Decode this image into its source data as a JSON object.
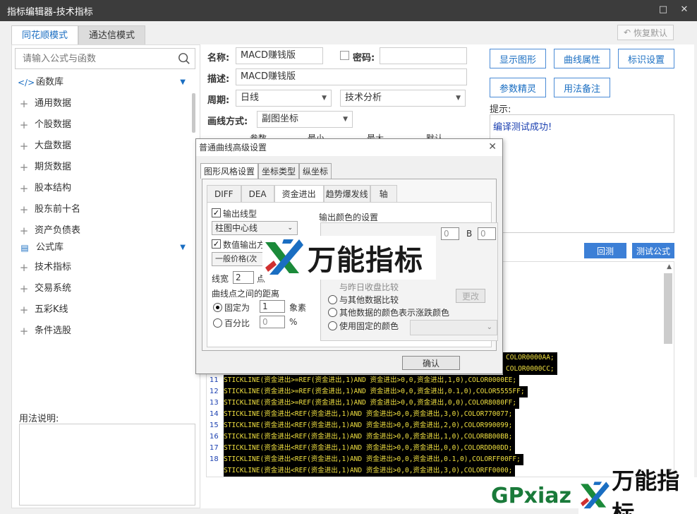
{
  "window": {
    "title": "指标编辑器-技术指标"
  },
  "mode_tabs": [
    {
      "label": "同花顺模式"
    },
    {
      "label": "通达信模式"
    }
  ],
  "restore_label": "恢复默认",
  "search": {
    "placeholder": "请输入公式与函数"
  },
  "tree": {
    "func_header": "函数库",
    "func_items": [
      "通用数据",
      "个股数据",
      "大盘数据",
      "期货数据",
      "股本结构",
      "股东前十名",
      "资产负债表"
    ],
    "formula_header": "公式库",
    "formula_items": [
      "技术指标",
      "交易系统",
      "五彩K线",
      "条件选股"
    ]
  },
  "usage_label": "用法说明:",
  "form": {
    "name_label": "名称:",
    "name_value": "MACD赚钱版",
    "password_label": "密码:",
    "desc_label": "描述:",
    "desc_value": "MACD赚钱版",
    "period_label": "周期:",
    "period_value": "日线",
    "category_value": "技术分析",
    "draw_label": "画线方式:",
    "draw_value": "副图坐标",
    "param_headers": [
      "参数",
      "最小",
      "最大",
      "默认"
    ]
  },
  "buttons": {
    "show_graph": "显示图形",
    "curve_attr": "曲线属性",
    "mark_setting": "标识设置",
    "param_tune": "参数精灵",
    "usage_note": "用法备注",
    "backtest": "回测",
    "test_formula": "测试公式"
  },
  "tip": {
    "label": "提示:",
    "text": "编译测试成功!"
  },
  "code_lines": [
    {
      "num": "",
      "text": "COLOR0000AA;"
    },
    {
      "num": "",
      "text": "COLOR0000CC;"
    },
    {
      "num": "11",
      "text": "STICKLINE(资金进出>=REF(资金进出,1)AND 资金进出>0,0,资金进出,1,0),COLOR0000EE;"
    },
    {
      "num": "12",
      "text": "STICKLINE(资金进出>=REF(资金进出,1)AND 资金进出>0,0,资金进出,0.1,0),COLOR5555FF;"
    },
    {
      "num": "13",
      "text": "STICKLINE(资金进出>=REF(资金进出,1)AND 资金进出>0,0,资金进出,0,0),COLOR8080FF;"
    },
    {
      "num": "14",
      "text": "STICKLINE(资金进出<REF(资金进出,1)AND 资金进出>0,0,资金进出,3,0),COLOR770077;"
    },
    {
      "num": "15",
      "text": "STICKLINE(资金进出<REF(资金进出,1)AND 资金进出>0,0,资金进出,2,0),COLOR990099;"
    },
    {
      "num": "16",
      "text": "STICKLINE(资金进出<REF(资金进出,1)AND 资金进出>0,0,资金进出,1,0),COLORBB00BB;"
    },
    {
      "num": "17",
      "text": "STICKLINE(资金进出<REF(资金进出,1)AND 资金进出>0,0,资金进出,0,0),COLORDD00DD;"
    },
    {
      "num": "18",
      "text": "STICKLINE(资金进出<REF(资金进出,1)AND 资金进出>0,0,资金进出,0.1,0),COLORFF00FF;"
    },
    {
      "num": "",
      "text": "STICKLINE(资金进出<REF(资金进出,1)AND 资金进出>0,0,资金进出,3,0),COLORFF0000;"
    }
  ],
  "dialog": {
    "title": "普通曲线高级设置",
    "tabs": [
      "图形风格设置",
      "坐标类型",
      "纵坐标"
    ],
    "sub_tabs": [
      "DIFF",
      "DEA",
      "资金进出",
      "趋势爆发线",
      "轴"
    ],
    "output_line_label": "输出线型",
    "line_type_value": "柱图中心线",
    "value_output_label": "数值输出方",
    "price_value": "一般价格(次",
    "line_width_label": "线宽",
    "line_width_value": "2",
    "line_width_unit": "点",
    "distance_label": "曲线点之间的距离",
    "fixed_label": "固定为",
    "fixed_value": "1",
    "fixed_unit": "象素",
    "percent_label": "百分比",
    "percent_value": "0",
    "percent_unit": "%",
    "color_group_label": "输出颜色的设置",
    "rgb_g_value": "0",
    "rgb_b_label": "B",
    "rgb_b_value": "0",
    "compare_prev": "与昨日收盘比较",
    "compare_other": "与其他数据比较",
    "other_color": "其他数据的颜色表示涨跌颜色",
    "use_fixed_color": "使用固定的颜色",
    "change_label": "更改",
    "ok_label": "确认"
  },
  "watermark": {
    "text": "万能指标",
    "corner_prefix": "GPxiaz",
    "corner_text": "万能指标"
  },
  "colors": {
    "accent": "#1a6ec2",
    "titlebar": "#3c3c3c",
    "button_blue": "#3c7fd6",
    "code_bg": "#000000",
    "code_fg": "#f0e040"
  }
}
